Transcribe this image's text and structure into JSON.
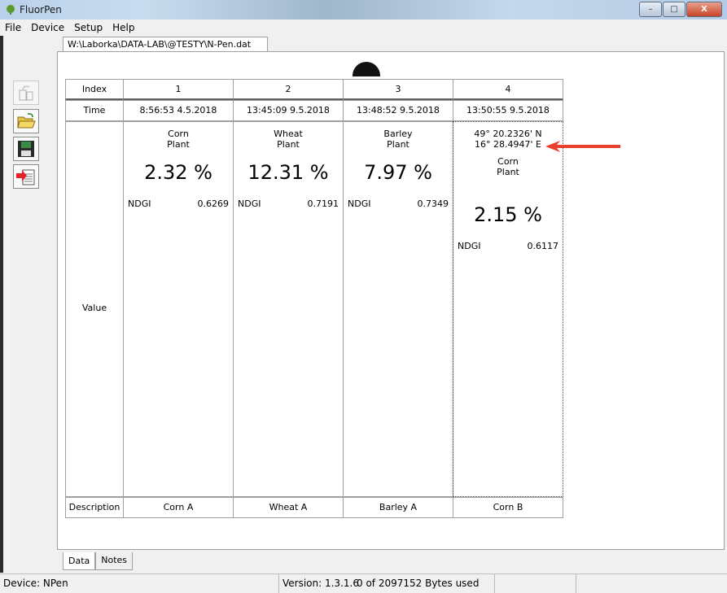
{
  "window": {
    "title": "FluorPen",
    "minimize_label": "–",
    "maximize_label": "□",
    "close_label": "X"
  },
  "menu": [
    "File",
    "Device",
    "Setup",
    "Help"
  ],
  "file_tab": "W:\\Laborka\\DATA-LAB\\@TESTY\\N-Pen.dat",
  "toolbar": {
    "icons": [
      "device-download-icon",
      "open-folder-icon",
      "save-floppy-icon",
      "export-icon"
    ]
  },
  "table": {
    "row_labels": {
      "index": "Index",
      "time": "Time",
      "value": "Value",
      "description": "Description"
    },
    "columns": [
      {
        "index": "1",
        "time": "8:56:53 4.5.2018",
        "gps_lat": "",
        "gps_lon": "",
        "crop": "Corn",
        "crop2": "Plant",
        "percent": "2.32 %",
        "ndgi_label": "NDGI",
        "ndgi_value": "0.6269",
        "description": "Corn A"
      },
      {
        "index": "2",
        "time": "13:45:09 9.5.2018",
        "gps_lat": "",
        "gps_lon": "",
        "crop": "Wheat",
        "crop2": "Plant",
        "percent": "12.31 %",
        "ndgi_label": "NDGI",
        "ndgi_value": "0.7191",
        "description": "Wheat A"
      },
      {
        "index": "3",
        "time": "13:48:52 9.5.2018",
        "gps_lat": "",
        "gps_lon": "",
        "crop": "Barley",
        "crop2": "Plant",
        "percent": "7.97 %",
        "ndgi_label": "NDGI",
        "ndgi_value": "0.7349",
        "description": "Barley A"
      },
      {
        "index": "4",
        "time": "13:50:55 9.5.2018",
        "gps_lat": "49° 20.2326' N",
        "gps_lon": "16° 28.4947' E",
        "crop": "Corn",
        "crop2": "Plant",
        "percent": "2.15 %",
        "ndgi_label": "NDGI",
        "ndgi_value": "0.6117",
        "description": "Corn B"
      }
    ]
  },
  "bottom_tabs": [
    "Data",
    "Notes"
  ],
  "status": {
    "device": "Device: NPen",
    "version": "Version: 1.3.1.6",
    "memory": "0 of 2097152 Bytes used"
  },
  "colors": {
    "arrow": "#e8402c",
    "app_icon": "#5a9a2a"
  }
}
